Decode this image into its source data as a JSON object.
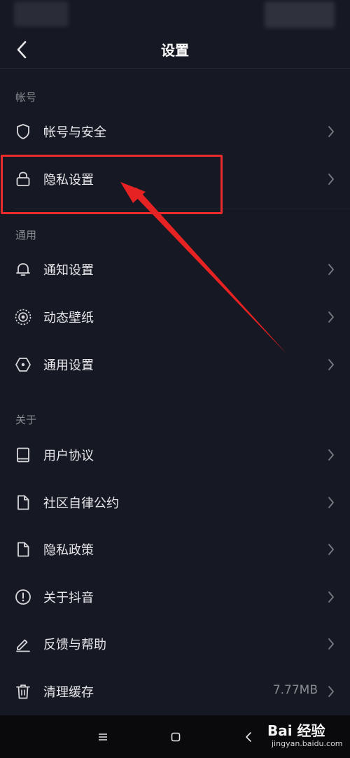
{
  "header": {
    "title": "设置"
  },
  "sections": {
    "account": "帐号",
    "general": "通用",
    "about": "关于"
  },
  "rows": {
    "account_security": "帐号与安全",
    "privacy_settings": "隐私设置",
    "notification_settings": "通知设置",
    "live_wallpaper": "动态壁纸",
    "general_settings": "通用设置",
    "user_agreement": "用户协议",
    "community_guidelines": "社区自律公约",
    "privacy_policy": "隐私政策",
    "about_douyin": "关于抖音",
    "feedback_help": "反馈与帮助",
    "clear_cache": "清理缓存",
    "cache_size": "7.77MB"
  },
  "watermark": {
    "brand": "Bai 经验",
    "url": "jingyan.baidu.com"
  },
  "colors": {
    "background": "#161823",
    "highlight": "#ea2b2b",
    "text": "#e8e8ec",
    "muted": "#8a8b91"
  }
}
